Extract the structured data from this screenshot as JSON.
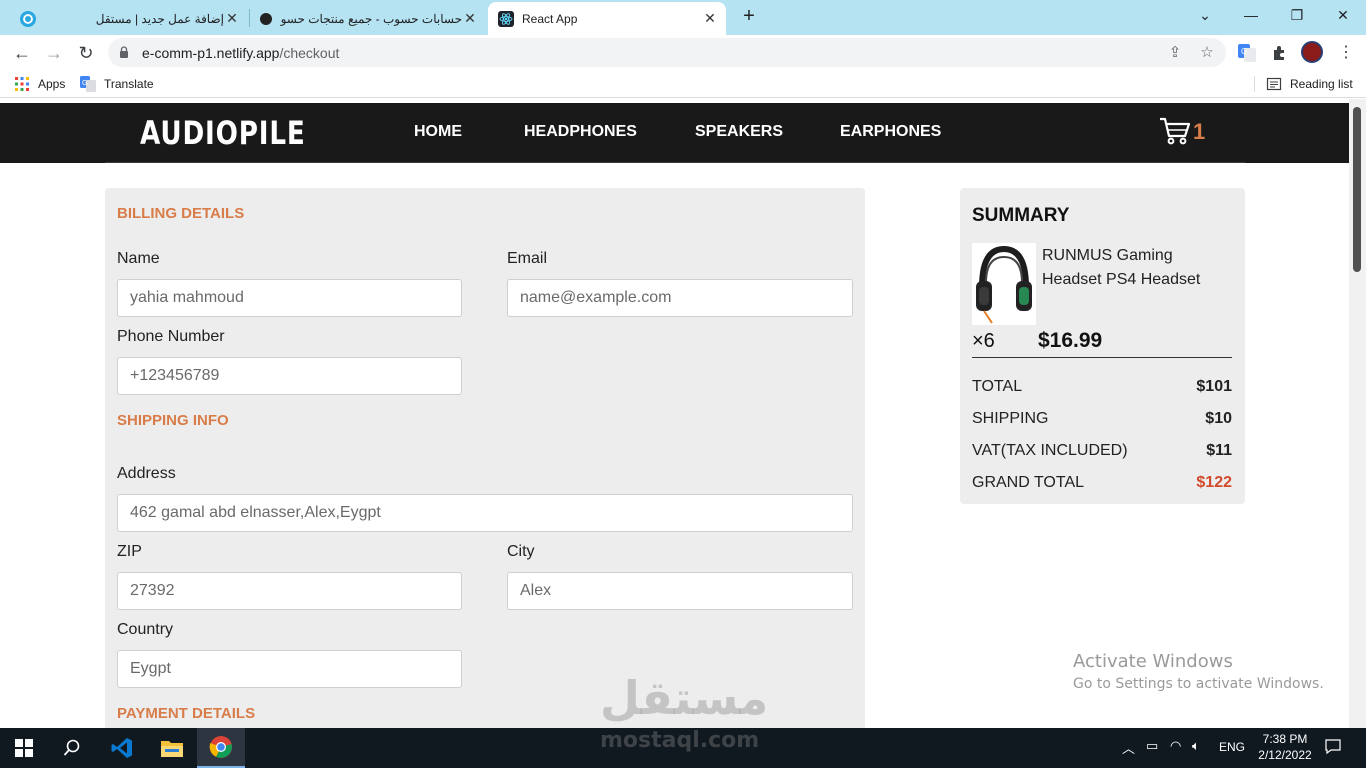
{
  "browser": {
    "tabs": [
      {
        "title": "إضافة عمل جديد | مستقل",
        "icon": "mostaql-icon",
        "active": false,
        "rtl": true
      },
      {
        "title": "حسابات حسوب - جميع منتجات حسوب",
        "icon": "hsoub-icon",
        "active": false,
        "rtl": true
      },
      {
        "title": "React App",
        "icon": "react-icon",
        "active": true,
        "rtl": false
      }
    ],
    "new_tab": "+",
    "address": {
      "host": "e-comm-p1.netlify.app",
      "path": "/checkout"
    },
    "bookmarks": [
      {
        "label": "Apps",
        "icon": "apps-grid-icon"
      },
      {
        "label": "Translate",
        "icon": "google-translate-icon"
      }
    ],
    "reading_list": "Reading list"
  },
  "site": {
    "logo": "AUDIOPILE",
    "nav": [
      "HOME",
      "HEADPHONES",
      "SPEAKERS",
      "EARPHONES"
    ],
    "cart_count": "1",
    "accent": "#d87d4a"
  },
  "billing": {
    "title": "BILLING DETAILS",
    "name_label": "Name",
    "name_value": "yahia mahmoud",
    "email_label": "Email",
    "email_placeholder": "name@example.com",
    "phone_label": "Phone Number",
    "phone_placeholder": "+123456789"
  },
  "shipping": {
    "title": "SHIPPING INFO",
    "address_label": "Address",
    "address_value": "462 gamal abd elnasser,Alex,Eygpt",
    "zip_label": "ZIP",
    "zip_value": "27392",
    "city_label": "City",
    "city_value": "Alex",
    "country_label": "Country",
    "country_value": "Eygpt"
  },
  "payment": {
    "title": "PAYMENT DETAILS"
  },
  "summary": {
    "title": "SUMMARY",
    "product_name": "RUNMUS Gaming Headset PS4 Headset",
    "qty": "×6",
    "price": "$16.99",
    "rows": [
      {
        "label": "TOTAL",
        "value": "$101"
      },
      {
        "label": "SHIPPING",
        "value": "$10"
      },
      {
        "label": "VAT(TAX INCLUDED)",
        "value": "$11"
      },
      {
        "label": "GRAND TOTAL",
        "value": "$122"
      }
    ]
  },
  "overlay": {
    "activate_title": "Activate Windows",
    "activate_sub": "Go to Settings to activate Windows.",
    "mostaql_ar": "مستقل",
    "mostaql_en": "mostaql.com"
  },
  "taskbar": {
    "lang": "ENG",
    "time": "7:38 PM",
    "date": "2/12/2022"
  }
}
